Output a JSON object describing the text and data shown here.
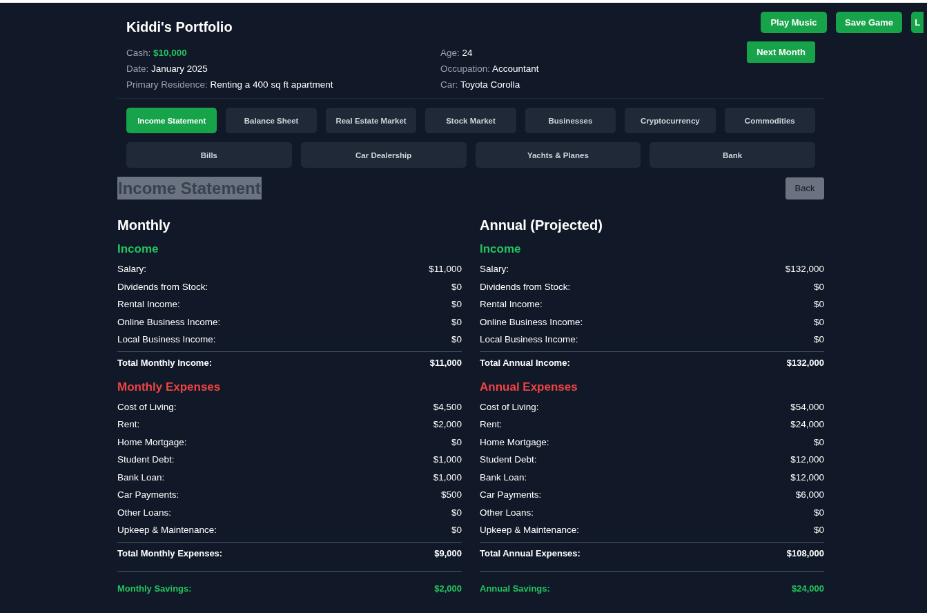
{
  "title": "Kiddi's Portfolio",
  "top_buttons": [
    "Play Music",
    "Save Game",
    "L"
  ],
  "info_left": [
    {
      "label": "Cash:",
      "value": "$10,000",
      "kind": "money"
    },
    {
      "label": "Date:",
      "value": "January 2025",
      "kind": "text"
    },
    {
      "label": "Primary Residence:",
      "value": "Renting a 400 sq ft apartment",
      "kind": "text"
    }
  ],
  "info_right": [
    {
      "label": "Age:",
      "value": "24",
      "kind": "text"
    },
    {
      "label": "Occupation:",
      "value": "Accountant",
      "kind": "text"
    },
    {
      "label": "Car:",
      "value": "Toyota Corolla",
      "kind": "text"
    }
  ],
  "next_month": "Next Month",
  "tab_rows": [
    [
      {
        "label": "Income Statement",
        "selected": true
      },
      {
        "label": "Balance Sheet",
        "selected": false
      },
      {
        "label": "Real Estate Market",
        "selected": false
      },
      {
        "label": "Stock Market",
        "selected": false
      },
      {
        "label": "Businesses",
        "selected": false
      },
      {
        "label": "Cryptocurrency",
        "selected": false
      },
      {
        "label": "Commodities",
        "selected": false
      }
    ],
    [
      {
        "label": "Bills",
        "selected": false
      },
      {
        "label": "Car Dealership",
        "selected": false
      },
      {
        "label": "Yachts & Planes",
        "selected": false
      },
      {
        "label": "Bank",
        "selected": false
      }
    ]
  ],
  "section": {
    "title": "Income Statement",
    "back": "Back"
  },
  "columns": [
    {
      "title": "Monthly",
      "income_title": "Income",
      "income": [
        {
          "label": "Salary:",
          "value": "$11,000"
        },
        {
          "label": "Dividends from Stock:",
          "value": "$0"
        },
        {
          "label": "Rental Income:",
          "value": "$0"
        },
        {
          "label": "Online Business Income:",
          "value": "$0"
        },
        {
          "label": "Local Business Income:",
          "value": "$0"
        }
      ],
      "income_total": {
        "label": "Total Monthly Income:",
        "value": "$11,000"
      },
      "expenses_title": "Monthly Expenses",
      "expenses": [
        {
          "label": "Cost of Living:",
          "value": "$4,500"
        },
        {
          "label": "Rent:",
          "value": "$2,000"
        },
        {
          "label": "Home Mortgage:",
          "value": "$0"
        },
        {
          "label": "Student Debt:",
          "value": "$1,000"
        },
        {
          "label": "Bank Loan:",
          "value": "$1,000"
        },
        {
          "label": "Car Payments:",
          "value": "$500"
        },
        {
          "label": "Other Loans:",
          "value": "$0"
        },
        {
          "label": "Upkeep & Maintenance:",
          "value": "$0"
        }
      ],
      "expenses_total": {
        "label": "Total Monthly Expenses:",
        "value": "$9,000"
      },
      "savings": {
        "label": "Monthly Savings:",
        "value": "$2,000"
      }
    },
    {
      "title": "Annual (Projected)",
      "income_title": "Income",
      "income": [
        {
          "label": "Salary:",
          "value": "$132,000"
        },
        {
          "label": "Dividends from Stock:",
          "value": "$0"
        },
        {
          "label": "Rental Income:",
          "value": "$0"
        },
        {
          "label": "Online Business Income:",
          "value": "$0"
        },
        {
          "label": "Local Business Income:",
          "value": "$0"
        }
      ],
      "income_total": {
        "label": "Total Annual Income:",
        "value": "$132,000"
      },
      "expenses_title": "Annual Expenses",
      "expenses": [
        {
          "label": "Cost of Living:",
          "value": "$54,000"
        },
        {
          "label": "Rent:",
          "value": "$24,000"
        },
        {
          "label": "Home Mortgage:",
          "value": "$0"
        },
        {
          "label": "Student Debt:",
          "value": "$12,000"
        },
        {
          "label": "Bank Loan:",
          "value": "$12,000"
        },
        {
          "label": "Car Payments:",
          "value": "$6,000"
        },
        {
          "label": "Other Loans:",
          "value": "$0"
        },
        {
          "label": "Upkeep & Maintenance:",
          "value": "$0"
        }
      ],
      "expenses_total": {
        "label": "Total Annual Expenses:",
        "value": "$108,000"
      },
      "savings": {
        "label": "Annual Savings:",
        "value": "$24,000"
      }
    }
  ]
}
